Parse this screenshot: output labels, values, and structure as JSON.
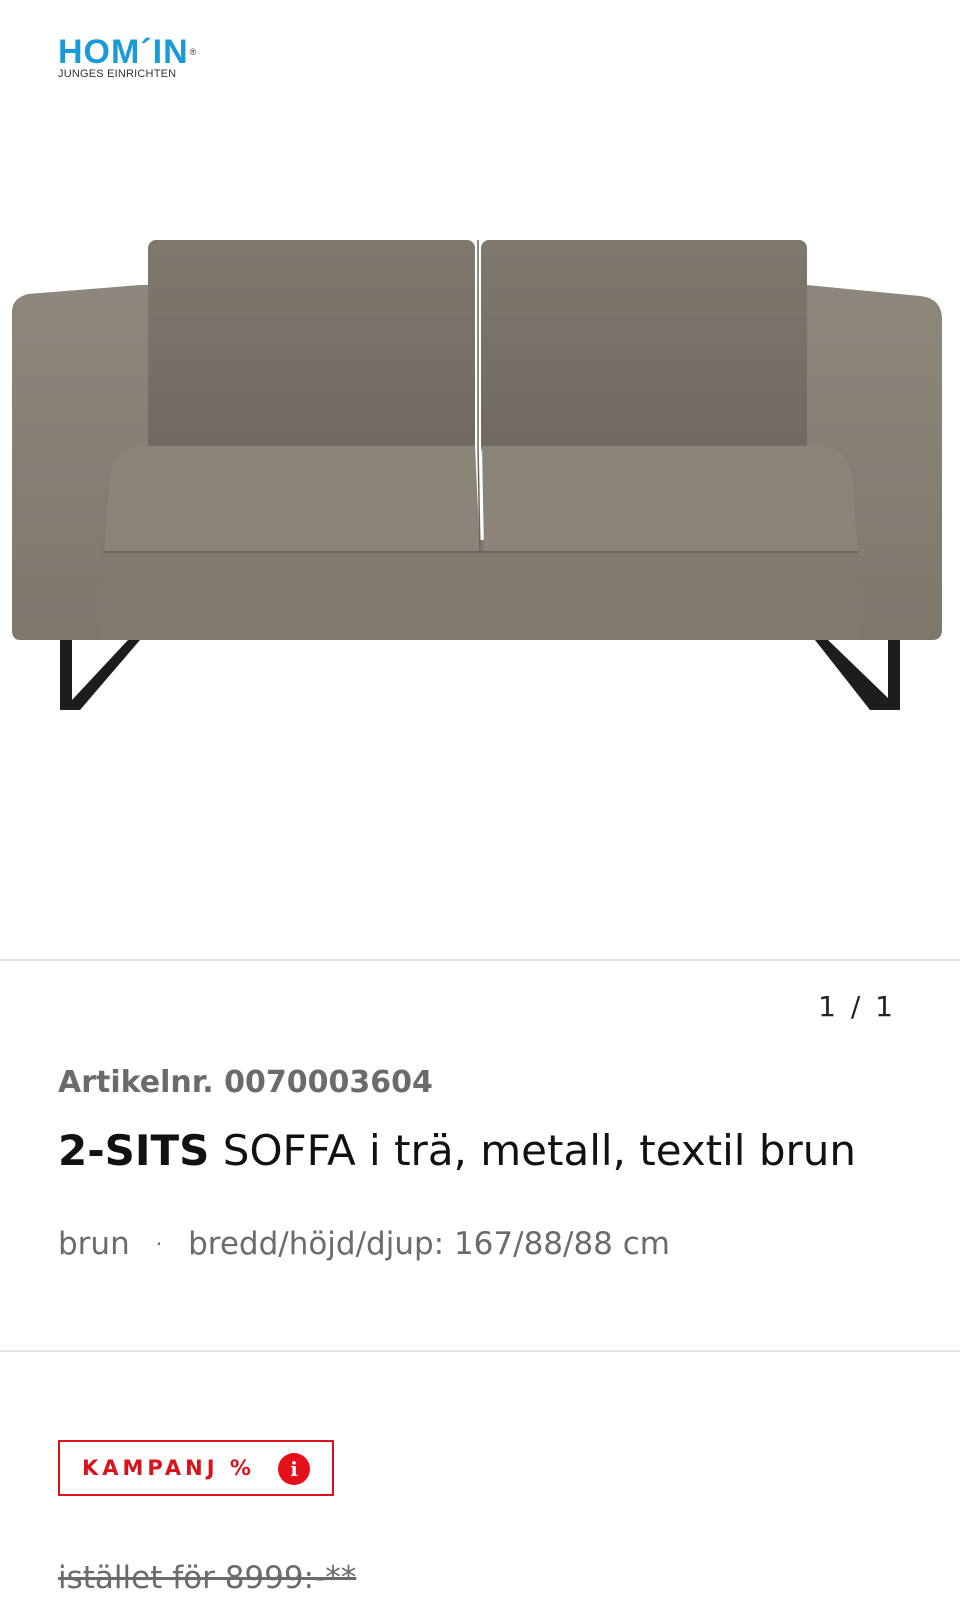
{
  "brand": {
    "logo_text": "HOM´IN",
    "logo_mark": "®",
    "tagline": "JUNGES EINRICHTEN",
    "color": "#1a9bd7"
  },
  "gallery": {
    "image_alt": "sofa-image",
    "counter": "1 / 1"
  },
  "product": {
    "article_label": "Artikelnr.",
    "article_number": "0070003604",
    "title_bold": "2-SITS",
    "title_rest": "SOFFA i trä, metall, textil brun",
    "color": "brun",
    "separator": "·",
    "dimensions": "bredd/höjd/djup: 167/88/88 cm"
  },
  "promo": {
    "badge_label": "KAMPANJ %",
    "badge_color": "#d8131b",
    "info_icon": "info-icon",
    "old_price": "istället för 8999:-**"
  }
}
